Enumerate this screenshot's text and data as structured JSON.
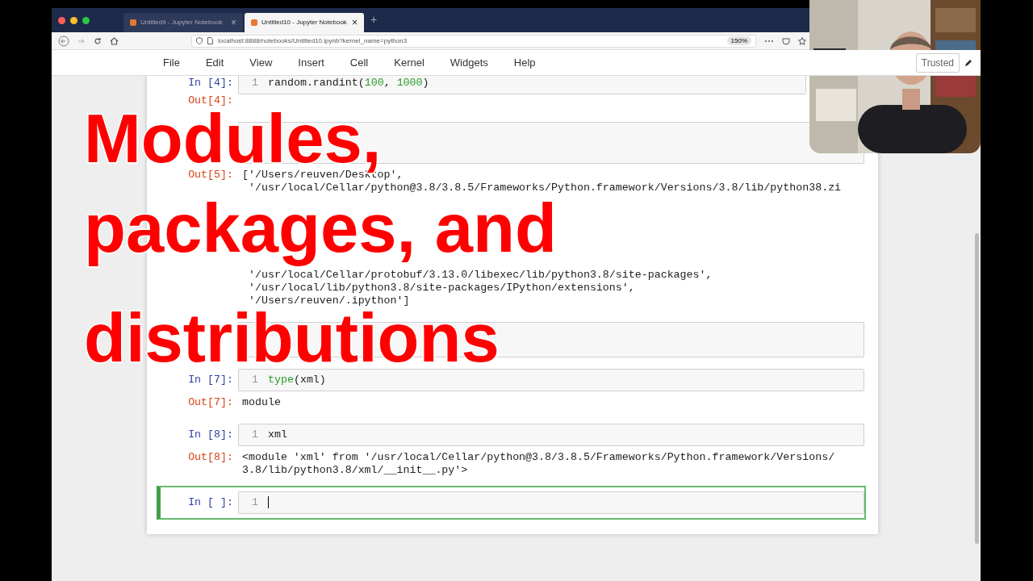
{
  "browser": {
    "tabs": [
      {
        "title": "Untitled9 - Jupyter Notebook",
        "close": "×",
        "selected": false
      },
      {
        "title": "Untitled10 - Jupyter Notebook",
        "close": "×",
        "selected": true
      }
    ],
    "new_tab": "+",
    "url": "localhost:8888/notebooks/Untitled10.ipynb?kernel_name=python3",
    "zoom": "150%"
  },
  "menu": [
    "File",
    "Edit",
    "View",
    "Insert",
    "Cell",
    "Kernel",
    "Widgets",
    "Help"
  ],
  "trusted": "Trusted",
  "cells": [
    {
      "prompt": "In [4]:",
      "line_number": "1",
      "selected": false,
      "code": [
        {
          "kind": "plain",
          "text": "random.randint("
        },
        {
          "kind": "number",
          "text": "100"
        },
        {
          "kind": "plain",
          "text": ", "
        },
        {
          "kind": "number",
          "text": "1000"
        },
        {
          "kind": "plain",
          "text": ")"
        }
      ],
      "output": {
        "prompt": "Out[4]:"
      }
    },
    {
      "selected": false,
      "output": {
        "prompt": "Out[5]:",
        "lines": [
          "['/Users/reuven/Desktop',",
          " '/usr/local/Cellar/python@3.8/3.8.5/Frameworks/Python.framework/Versions/3.8/lib/python38.zi"
        ],
        "continued_lines": [
          " '/usr/local/Cellar/protobuf/3.13.0/libexec/lib/python3.8/site-packages',",
          " '/usr/local/lib/python3.8/site-packages/IPython/extensions',",
          " '/Users/reuven/.ipython']"
        ]
      }
    },
    {
      "selected": false
    },
    {
      "prompt": "In [7]:",
      "line_number": "1",
      "selected": false,
      "code": [
        {
          "kind": "builtin",
          "text": "type"
        },
        {
          "kind": "plain",
          "text": "(xml)"
        }
      ],
      "output": {
        "prompt": "Out[7]:",
        "lines": [
          "module"
        ]
      }
    },
    {
      "prompt": "In [8]:",
      "line_number": "1",
      "selected": false,
      "code": [
        {
          "kind": "plain",
          "text": "xml"
        }
      ],
      "output": {
        "prompt": "Out[8]:",
        "lines": [
          "<module 'xml' from '/usr/local/Cellar/python@3.8/3.8.5/Frameworks/Python.framework/Versions/",
          "3.8/lib/python3.8/xml/__init__.py'>"
        ]
      }
    },
    {
      "prompt": "In [ ]:",
      "line_number": "1",
      "selected": true
    }
  ],
  "title_overlay": [
    "Modules,",
    "packages, and",
    "distributions"
  ]
}
